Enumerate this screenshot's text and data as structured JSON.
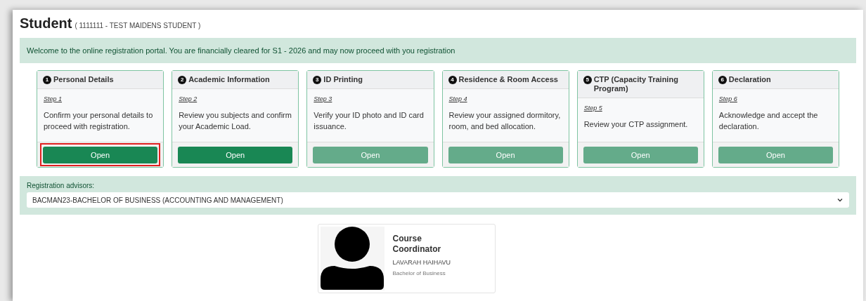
{
  "page": {
    "title": "Student",
    "subtitle": "( 1111111 - TEST MAIDENS STUDENT )"
  },
  "alert": "Welcome to the online registration portal. You are financially cleared for S1 - 2026 and may now proceed with you registration",
  "steps": [
    {
      "number": "1",
      "title": "Personal Details",
      "step": "Step 1",
      "description": "Confirm your personal details to proceed with registration.",
      "button": "Open",
      "disabled": false,
      "highlighted": true
    },
    {
      "number": "2",
      "title": "Academic Information",
      "step": "Step 2",
      "description": "Review you subjects and confirm your Academic Load.",
      "button": "Open",
      "disabled": false,
      "highlighted": false
    },
    {
      "number": "3",
      "title": "ID Printing",
      "step": "Step 3",
      "description": "Verify your ID photo and ID card issuance.",
      "button": "Open",
      "disabled": true,
      "highlighted": false
    },
    {
      "number": "4",
      "title": "Residence & Room Access",
      "step": "Step 4",
      "description": "Review your assigned dormitory, room, and bed allocation.",
      "button": "Open",
      "disabled": true,
      "highlighted": false
    },
    {
      "number": "5",
      "title": "CTP (Capacity Training Program)",
      "step": "Step 5",
      "description": "Review your CTP assignment.",
      "button": "Open",
      "disabled": true,
      "highlighted": false
    },
    {
      "number": "6",
      "title": "Declaration",
      "step": "Step 6",
      "description": "Acknowledge and accept the declaration.",
      "button": "Open",
      "disabled": true,
      "highlighted": false
    }
  ],
  "advisors": {
    "label": "Registration advisors:",
    "value": "BACMAN23-BACHELOR OF BUSINESS (ACCOUNTING AND MANAGEMENT)"
  },
  "coordinator": {
    "role": "Course Coordinator",
    "name": "LAVARAH HAIHAVU",
    "program": "Bachelor of Business"
  }
}
